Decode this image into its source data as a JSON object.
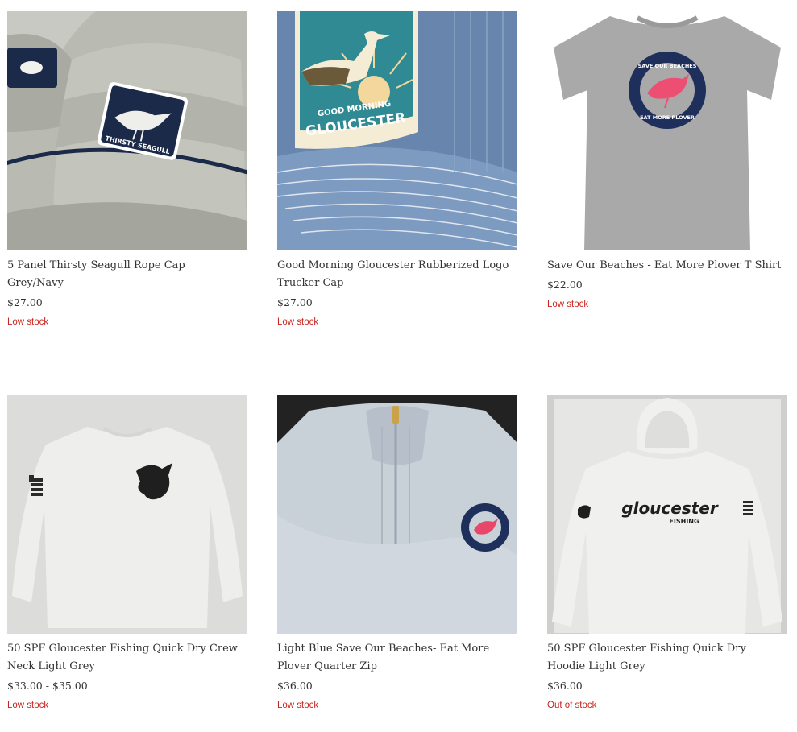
{
  "products": [
    {
      "title": "5 Panel Thirsty Seagull Rope Cap Grey/Navy",
      "price": "$27.00",
      "stock": "Low stock",
      "patch_text": "THIRSTY SEAGULL"
    },
    {
      "title": "Good Morning Gloucester Rubberized Logo Trucker Cap",
      "price": "$27.00",
      "stock": "Low stock",
      "patch_text_top": "GOOD MORNING",
      "patch_text_main": "GLOUCESTER"
    },
    {
      "title": "Save Our Beaches - Eat More Plover T Shirt",
      "price": "$22.00",
      "stock": "Low stock",
      "badge_text_top": "SAVE OUR BEACHES",
      "badge_text_bottom": "EAT MORE PLOVER"
    },
    {
      "title": "50 SPF Gloucester Fishing Quick Dry Crew Neck Light Grey",
      "price": "$33.00 - $35.00",
      "stock": "Low stock"
    },
    {
      "title": "Light Blue Save Our Beaches- Eat More Plover Quarter Zip",
      "price": "$36.00",
      "stock": "Low stock"
    },
    {
      "title": "50 SPF Gloucester Fishing Quick Dry Hoodie Light Grey",
      "price": "$36.00",
      "stock": "Out of stock",
      "print_main": "gloucester",
      "print_sub": "FISHING"
    }
  ],
  "colors": {
    "stock_alert": "#c9241e",
    "text": "#333333",
    "navy": "#1c2a4a",
    "plover_pink": "#e8476a"
  }
}
